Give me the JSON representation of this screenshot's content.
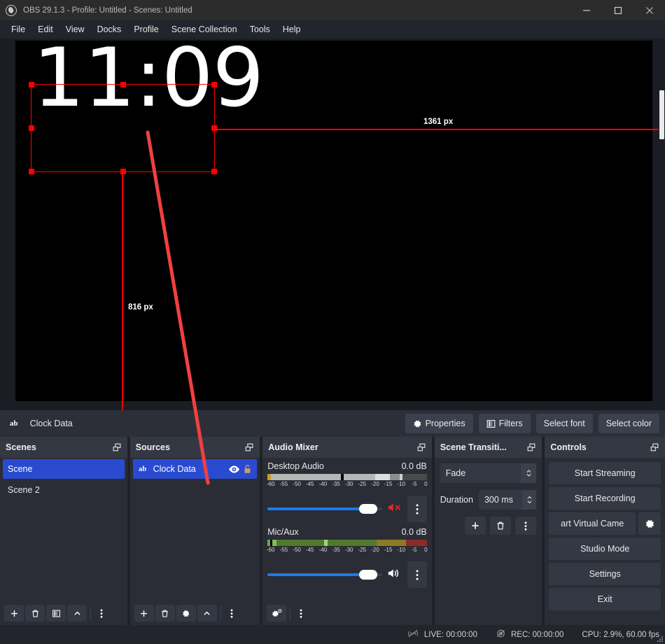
{
  "window": {
    "title": "OBS 29.1.3 - Profile: Untitled - Scenes: Untitled",
    "logo_icon": "obs-logo-icon",
    "minimize_icon": "minimize-icon",
    "maximize_icon": "maximize-icon",
    "close_icon": "close-icon"
  },
  "menubar": {
    "items": [
      {
        "label": "File"
      },
      {
        "label": "Edit"
      },
      {
        "label": "View"
      },
      {
        "label": "Docks"
      },
      {
        "label": "Profile"
      },
      {
        "label": "Scene Collection"
      },
      {
        "label": "Tools"
      },
      {
        "label": "Help"
      }
    ]
  },
  "preview": {
    "clock_text": "11:09",
    "width_label": "1361 px",
    "height_label": "816 px",
    "selection_color": "#ff0000",
    "annotation_color": "#f04040",
    "canvas_color": "#000000"
  },
  "source_toolbar": {
    "source_icon": "ab",
    "source_name": "Clock Data",
    "properties_label": "Properties",
    "properties_icon": "gear-icon",
    "filters_label": "Filters",
    "filters_icon": "filters-icon",
    "select_font_label": "Select font",
    "select_color_label": "Select color"
  },
  "scenes": {
    "title": "Scenes",
    "float_icon": "undock-icon",
    "items": [
      {
        "label": "Scene",
        "selected": true
      },
      {
        "label": "Scene 2",
        "selected": false
      }
    ],
    "footer": [
      {
        "icon": "plus-icon"
      },
      {
        "icon": "trash-icon"
      },
      {
        "icon": "filters-icon"
      },
      {
        "icon": "chevron-up-icon"
      },
      {
        "icon": "vertical-dots-icon"
      }
    ]
  },
  "sources": {
    "title": "Sources",
    "float_icon": "undock-icon",
    "items": [
      {
        "type_icon": "ab",
        "label": "Clock Data",
        "selected": true,
        "visibility_icon": "eye-icon",
        "lock_icon": "unlocked-icon"
      }
    ],
    "footer": [
      {
        "icon": "plus-icon"
      },
      {
        "icon": "trash-icon"
      },
      {
        "icon": "gear-icon"
      },
      {
        "icon": "chevron-up-icon"
      },
      {
        "icon": "vertical-dots-icon"
      }
    ]
  },
  "audio_mixer": {
    "title": "Audio Mixer",
    "float_icon": "undock-icon",
    "tick_labels": [
      "-60",
      "-55",
      "-50",
      "-45",
      "-40",
      "-35",
      "-30",
      "-25",
      "-20",
      "-15",
      "-10",
      "-5",
      "0"
    ],
    "tracks": [
      {
        "name": "Desktop Audio",
        "db": "0.0 dB",
        "muted": true,
        "mute_icon": "speaker-muted-icon",
        "menu_icon": "vertical-dots-icon",
        "volume_percent": 100,
        "meter_style": "inactive"
      },
      {
        "name": "Mic/Aux",
        "db": "0.0 dB",
        "muted": false,
        "mute_icon": "speaker-icon",
        "menu_icon": "vertical-dots-icon",
        "volume_percent": 100,
        "meter_style": "active"
      }
    ],
    "footer": [
      {
        "icon": "audio-settings-icon"
      },
      {
        "icon": "vertical-dots-icon"
      }
    ]
  },
  "scene_transitions": {
    "title": "Scene Transiti...",
    "float_icon": "undock-icon",
    "transition_value": "Fade",
    "duration_label": "Duration",
    "duration_value": "300 ms",
    "buttons": [
      {
        "icon": "plus-icon"
      },
      {
        "icon": "trash-icon"
      },
      {
        "icon": "vertical-dots-icon"
      }
    ]
  },
  "controls": {
    "title": "Controls",
    "float_icon": "undock-icon",
    "start_streaming_label": "Start Streaming",
    "start_recording_label": "Start Recording",
    "virtual_camera_label": "art Virtual Came",
    "virtual_camera_gear_icon": "gear-icon",
    "studio_mode_label": "Studio Mode",
    "settings_label": "Settings",
    "exit_label": "Exit"
  },
  "statusbar": {
    "live_icon": "stream-inactive-icon",
    "live_label": "LIVE: 00:00:00",
    "rec_icon": "record-inactive-icon",
    "rec_label": "REC: 00:00:00",
    "cpu_label": "CPU: 2.9%, 60.00 fps",
    "grip_icon": "resize-grip-icon"
  }
}
